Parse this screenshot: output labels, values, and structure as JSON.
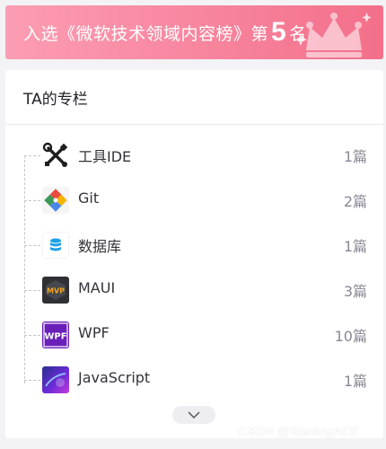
{
  "banner": {
    "prefix": "入选《微软技术领域内容榜》第",
    "rank": "5",
    "suffix": "名",
    "crown_icon": "crown-icon"
  },
  "column": {
    "title": "TA的专栏",
    "items": [
      {
        "name": "工具IDE",
        "count": "1篇",
        "icon": "tools-icon"
      },
      {
        "name": "Git",
        "count": "2篇",
        "icon": "git-icon"
      },
      {
        "name": "数据库",
        "count": "1篇",
        "icon": "database-icon"
      },
      {
        "name": "MAUI",
        "count": "3篇",
        "icon": "mvp-icon"
      },
      {
        "name": "WPF",
        "count": "10篇",
        "icon": "wpf-icon"
      },
      {
        "name": "JavaScript",
        "count": "1篇",
        "icon": "javascript-icon"
      }
    ],
    "expand_icon": "chevron-down-icon"
  },
  "watermark": "CSDN @StartingACE",
  "colors": {
    "banner_start": "#fc9db3",
    "banner_end": "#f36f8a",
    "text": "#333339",
    "count": "#888896"
  }
}
